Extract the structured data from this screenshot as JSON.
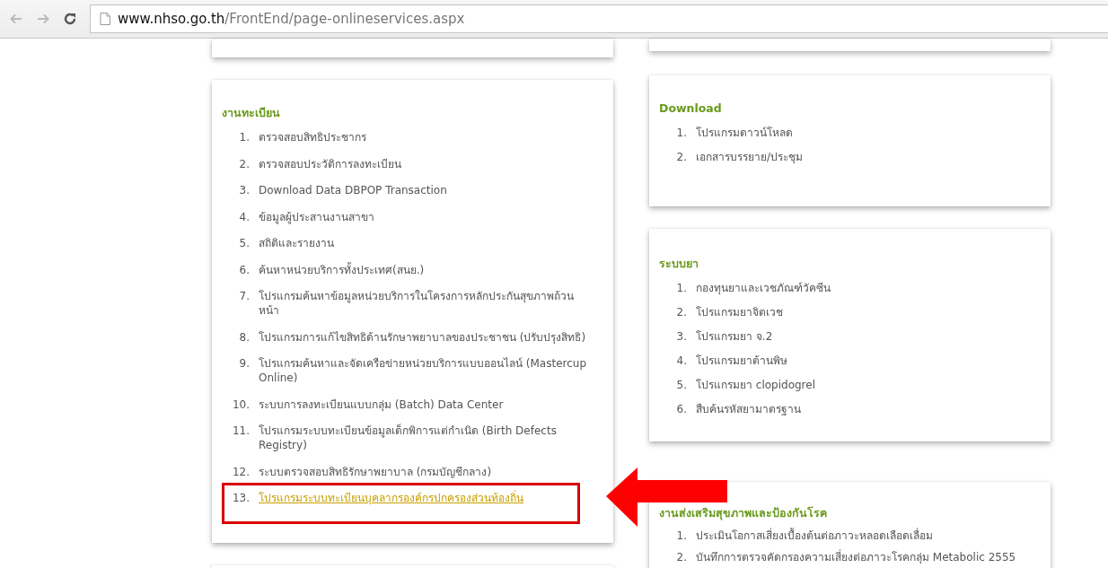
{
  "browser": {
    "url_host": "www.nhso.go.th",
    "url_path": "/FrontEnd/page-onlineservices.aspx"
  },
  "columns": [
    {
      "cards": [
        {
          "kind": "partial"
        },
        {
          "kind": "section",
          "heading": "งานทะเบียน",
          "items": [
            {
              "number": "1.",
              "text": "ตรวจสอบสิทธิประชากร",
              "highlighted": false
            },
            {
              "number": "2.",
              "text": "ตรวจสอบประวัติการลงทะเบียน",
              "highlighted": false
            },
            {
              "number": "3.",
              "text": "Download Data DBPOP Transaction",
              "highlighted": false
            },
            {
              "number": "4.",
              "text": "ข้อมูลผู้ประสานงานสาขา",
              "highlighted": false
            },
            {
              "number": "5.",
              "text": "สถิติและรายงาน",
              "highlighted": false
            },
            {
              "number": "6.",
              "text": "ค้นหาหน่วยบริการทั้งประเทศ(สนย.)",
              "highlighted": false
            },
            {
              "number": "7.",
              "text": "โปรแกรมค้นหาข้อมูลหน่วยบริการในโครงการหลักประกันสุขภาพถ้วนหน้า",
              "highlighted": false
            },
            {
              "number": "8.",
              "text": "โปรแกรมการแก้ไขสิทธิด้านรักษาพยาบาลของประชาชน (ปรับปรุงสิทธิ)",
              "highlighted": false
            },
            {
              "number": "9.",
              "text": "โปรแกรมค้นหาและจัดเครือข่ายหน่วยบริการแบบออนไลน์ (Mastercup Online)",
              "highlighted": false
            },
            {
              "number": "10.",
              "text": "ระบบการลงทะเบียนแบบกลุ่ม (Batch) Data Center",
              "highlighted": false
            },
            {
              "number": "11.",
              "text": "โปรแกรมระบบทะเบียนข้อมูลเด็กพิการแต่กำเนิด (Birth Defects Registry)",
              "highlighted": false
            },
            {
              "number": "12.",
              "text": "ระบบตรวจสอบสิทธิรักษาพยาบาล (กรมบัญชีกลาง)",
              "highlighted": false
            },
            {
              "number": "13.",
              "text": "โปรแกรมระบบทะเบียนบุคลากรองค์กรปกครองส่วนท้องถิ่น",
              "highlighted": true
            }
          ]
        },
        {
          "kind": "partial"
        }
      ]
    },
    {
      "cards": [
        {
          "kind": "partial"
        },
        {
          "kind": "section",
          "heading": "Download",
          "items": [
            {
              "number": "1.",
              "text": "โปรแกรมดาวน์โหลด",
              "highlighted": false
            },
            {
              "number": "2.",
              "text": "เอกสารบรรยาย/ประชุม",
              "highlighted": false
            }
          ]
        },
        {
          "kind": "section",
          "heading": "ระบบยา",
          "items": [
            {
              "number": "1.",
              "text": "กองทุนยาและเวชภัณฑ์วัคซีน",
              "highlighted": false
            },
            {
              "number": "2.",
              "text": "โปรแกรมยาจิตเวช",
              "highlighted": false
            },
            {
              "number": "3.",
              "text": "โปรแกรมยา จ.2",
              "highlighted": false
            },
            {
              "number": "4.",
              "text": "โปรแกรมยาต้านพิษ",
              "highlighted": false
            },
            {
              "number": "5.",
              "text": "โปรแกรมยา clopidogrel",
              "highlighted": false
            },
            {
              "number": "6.",
              "text": "สืบค้นรหัสยามาตรฐาน",
              "highlighted": false
            }
          ]
        },
        {
          "kind": "section",
          "heading": "งานส่งเสริมสุขภาพและป้องกันโรค",
          "items": [
            {
              "number": "1.",
              "text": "ประเมินโอกาสเสี่ยงเบื้องต้นต่อภาวะหลอดเลือดเลื่อม",
              "highlighted": false
            },
            {
              "number": "2.",
              "text": "บันทึกการตรวจคัดกรองความเสี่ยงต่อภาวะโรคกลุ่ม Metabolic 2555",
              "highlighted": false
            }
          ]
        }
      ]
    }
  ]
}
